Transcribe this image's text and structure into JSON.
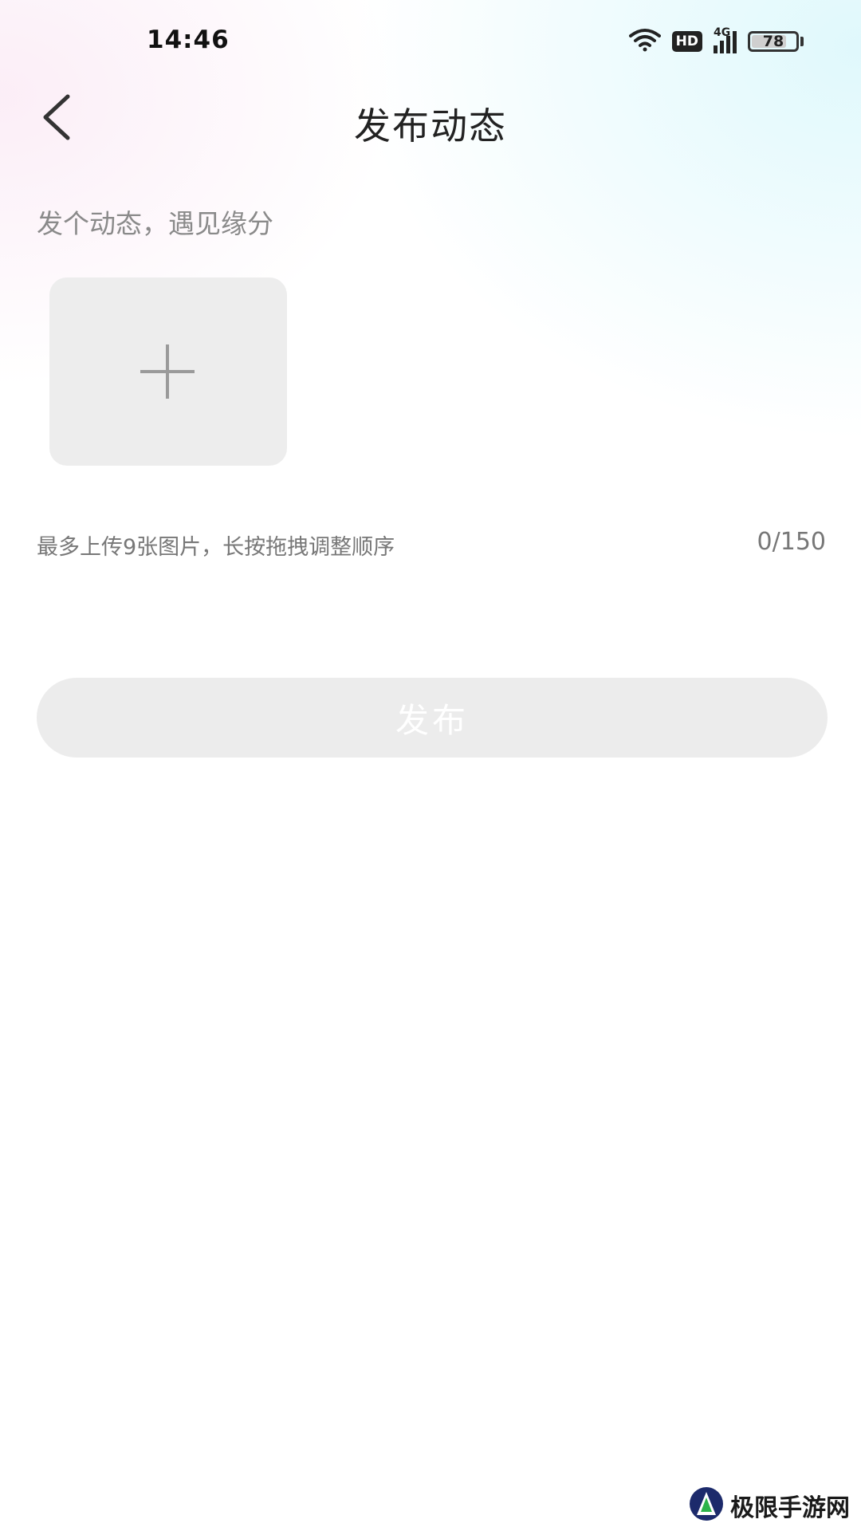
{
  "status_bar": {
    "time": "14:46",
    "network_badge": "HD",
    "signal_label": "4G",
    "battery_level": "78",
    "icons": [
      "wifi-icon",
      "hd-icon",
      "signal-4g-icon",
      "battery-icon"
    ]
  },
  "header": {
    "title": "发布动态",
    "back_icon": "chevron-left-icon"
  },
  "composer": {
    "placeholder": "发个动态，遇见缘分",
    "value": "",
    "add_photo_icon": "plus-icon",
    "hint": "最多上传9张图片，长按拖拽调整顺序",
    "char_count": "0/150"
  },
  "actions": {
    "publish_label": "发布"
  },
  "watermark": {
    "text": "极限手游网",
    "icon": "logo-icon"
  },
  "colors": {
    "publish_disabled_bg": "#ececec",
    "tile_bg": "#ededed",
    "text_muted": "#777777"
  }
}
